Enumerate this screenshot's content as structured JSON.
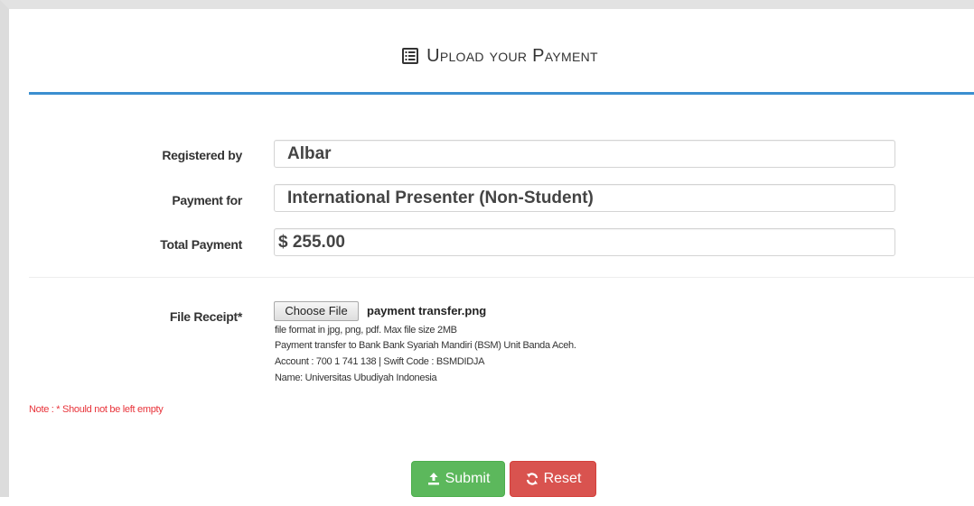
{
  "header": {
    "title": "Upload your Payment",
    "icon": "list-alt-icon"
  },
  "form": {
    "registered_by": {
      "label": "Registered by",
      "value": "Albar"
    },
    "payment_for": {
      "label": "Payment for",
      "value": "International Presenter (Non-Student)"
    },
    "total_payment": {
      "label": "Total Payment",
      "value": "$ 255.00"
    },
    "file_receipt": {
      "label": "File Receipt*",
      "button_label": "Choose File",
      "file_name": "payment transfer.png",
      "help_lines": [
        "file format in jpg, png, pdf. Max file size 2MB",
        "Payment transfer to Bank Bank Syariah Mandiri (BSM) Unit Banda Aceh.",
        "Account : 700 1 741 138 | Swift Code : BSMDIDJA",
        "Name: Universitas Ubudiyah Indonesia"
      ]
    },
    "note": "Note : * Should not be left empty"
  },
  "actions": {
    "submit_label": "Submit",
    "submit_icon": "upload-icon",
    "reset_label": "Reset",
    "reset_icon": "refresh-icon"
  },
  "colors": {
    "accent_rule": "#3b8fd0",
    "submit": "#5cb85c",
    "reset": "#d9534f",
    "note": "#e8333a"
  }
}
